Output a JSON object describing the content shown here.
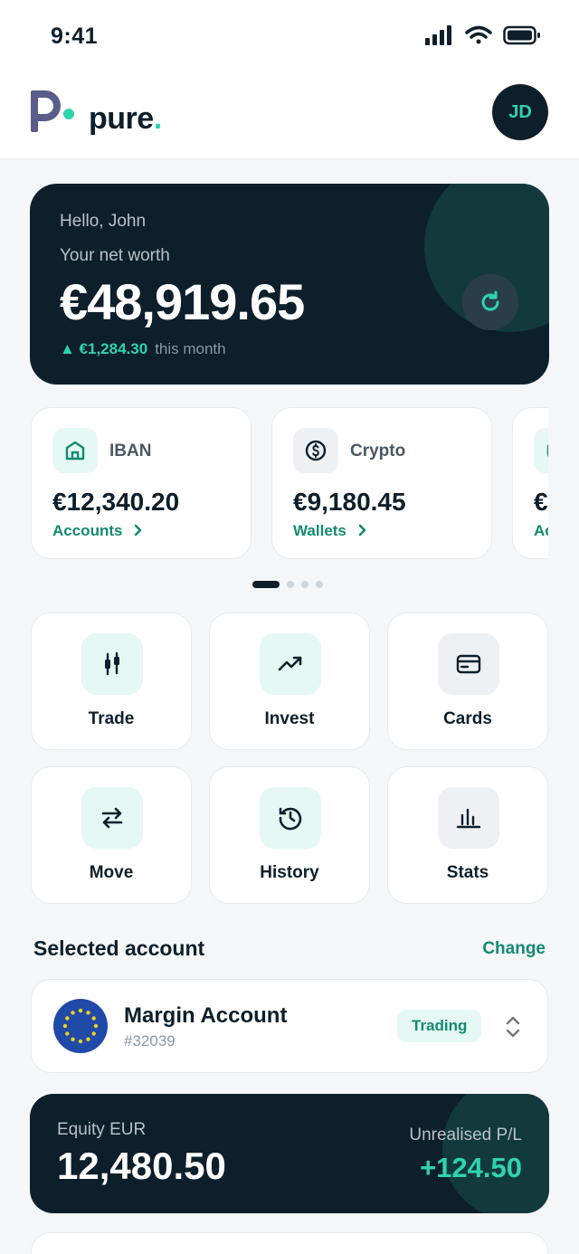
{
  "status_bar": {
    "time": "9:41"
  },
  "header": {
    "brand": "pure",
    "brand_dot": ".",
    "avatar_initials": "JD"
  },
  "net_worth": {
    "greeting": "Hello, John",
    "label": "Your net worth",
    "value": "€48,919.65",
    "change": "▲ €1,284.30",
    "change_period": "this month"
  },
  "accounts": [
    {
      "name": "IBAN",
      "amount": "€12,340.20",
      "link": "Accounts",
      "icon": "bank-icon"
    },
    {
      "name": "Crypto",
      "amount": "€9,180.45",
      "link": "Wallets",
      "icon": "coin-icon"
    },
    {
      "name": "",
      "amount": "€",
      "link": "Ac",
      "icon": "card-icon"
    }
  ],
  "carousel": {
    "active_index": 0,
    "count": 4
  },
  "actions": [
    {
      "label": "Trade",
      "icon": "candlestick-icon"
    },
    {
      "label": "Invest",
      "icon": "trending-up-icon"
    },
    {
      "label": "Cards",
      "icon": "credit-card-icon"
    },
    {
      "label": "Move",
      "icon": "transfer-icon"
    },
    {
      "label": "History",
      "icon": "history-icon"
    },
    {
      "label": "Stats",
      "icon": "bar-chart-icon"
    }
  ],
  "selected_account": {
    "title": "Selected account",
    "change_label": "Change",
    "name": "Margin Account",
    "number": "#32039",
    "badge": "Trading"
  },
  "equity": {
    "label": "Equity EUR",
    "value": "12,480.50",
    "pl_label": "Unrealised P/L",
    "pl_value": "+124.50"
  },
  "colors": {
    "navy": "#0d1f2b",
    "accent": "#2fd3b0",
    "link_green": "#128b6e"
  }
}
